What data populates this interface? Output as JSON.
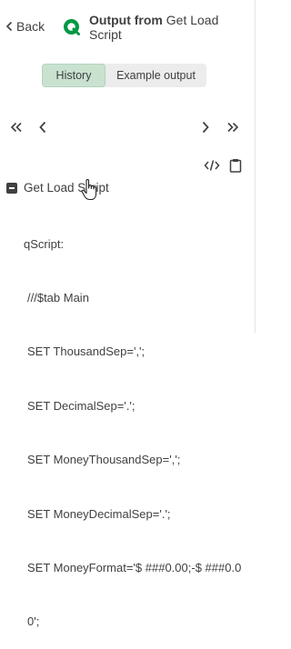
{
  "header": {
    "back_label": "Back",
    "title_strong": "Output from",
    "title_rest": "Get Load Script"
  },
  "tabs": {
    "history_label": "History",
    "example_label": "Example output",
    "selected": "History"
  },
  "icons": {
    "back": "chevron-left-icon",
    "logo": "qlik-logo-icon",
    "first": "double-chevron-left-icon",
    "prev": "chevron-left-icon",
    "next": "chevron-right-icon",
    "last": "double-chevron-right-icon",
    "code": "code-icon",
    "copy": "clipboard-icon",
    "collapse": "minus-square-icon",
    "cursor": "hand-pointer-icon"
  },
  "colors": {
    "accent_green": "#009845",
    "selected_tab_bg": "#c9e2d0",
    "text": "#404040"
  },
  "output": {
    "node_label": "Get Load Script",
    "key": "qScript:",
    "lines": [
      "///$tab Main",
      "SET ThousandSep=',';",
      "SET DecimalSep='.';",
      "SET MoneyThousandSep=',';",
      "SET MoneyDecimalSep='.';",
      "SET MoneyFormat='$ ###0.00;-$ ###0.0",
      "0';"
    ]
  }
}
